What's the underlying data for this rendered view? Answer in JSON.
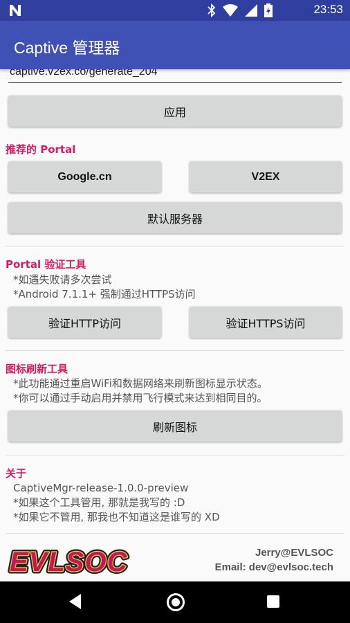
{
  "status_bar": {
    "time": "23:53"
  },
  "app_bar": {
    "title": "Captive 管理器"
  },
  "url_field": {
    "value": "captive.v2ex.co/generate_204"
  },
  "apply_button": "应用",
  "recommended": {
    "title": "推荐的 Portal",
    "google_button": "Google.cn",
    "v2ex_button": "V2EX",
    "default_button": "默认服务器"
  },
  "verify": {
    "title": "Portal 验证工具",
    "notes": [
      "*如遇失败请多次尝试",
      "*Android 7.1.1+ 强制通过HTTPS访问"
    ],
    "http_button": "验证HTTP访问",
    "https_button": "验证HTTPS访问"
  },
  "refresh": {
    "title": "图标刷新工具",
    "notes": [
      "*此功能通过重启WiFi和数据网络来刷新图标显示状态。",
      "*你可以通过手动启用并禁用飞行模式来达到相同目的。"
    ],
    "button": "刷新图标"
  },
  "about": {
    "title": "关于",
    "lines": [
      "CaptiveMgr-release-1.0.0-preview",
      "*如果这个工具管用, 那就是我写的 :D",
      "*如果它不管用, 那我也不知道这是谁写的 XD"
    ]
  },
  "footer": {
    "logo_text": "EVLSOC",
    "contact_name": "Jerry@EVLSOC",
    "contact_email": "Email: dev@evlsoc.tech"
  },
  "colors": {
    "primary": "#3f51b5",
    "primary_dark": "#303f9f",
    "accent": "#d81b60",
    "button": "#d6d7d7"
  }
}
